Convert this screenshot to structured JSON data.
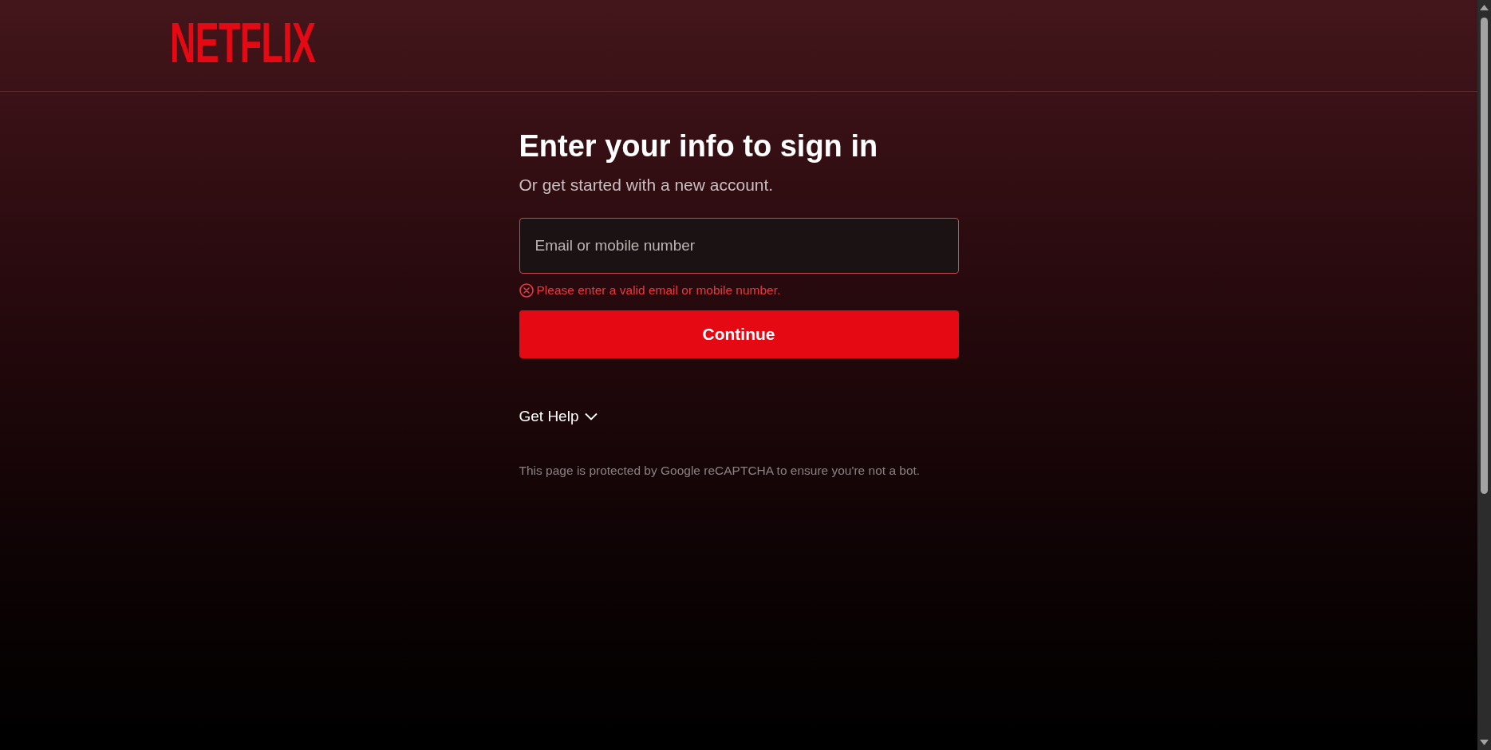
{
  "header": {
    "logo": "NETFLIX"
  },
  "form": {
    "title": "Enter your info to sign in",
    "subtitle": "Or get started with a new account.",
    "email_field": {
      "placeholder": "Email or mobile number",
      "invalid": true,
      "error": "Please enter a valid email or mobile number."
    },
    "continue_button": "Continue"
  },
  "help": {
    "label": "Get Help",
    "expanded": false
  },
  "recaptcha_notice": "This page is protected by Google reCAPTCHA to ensure you're not a bot."
}
